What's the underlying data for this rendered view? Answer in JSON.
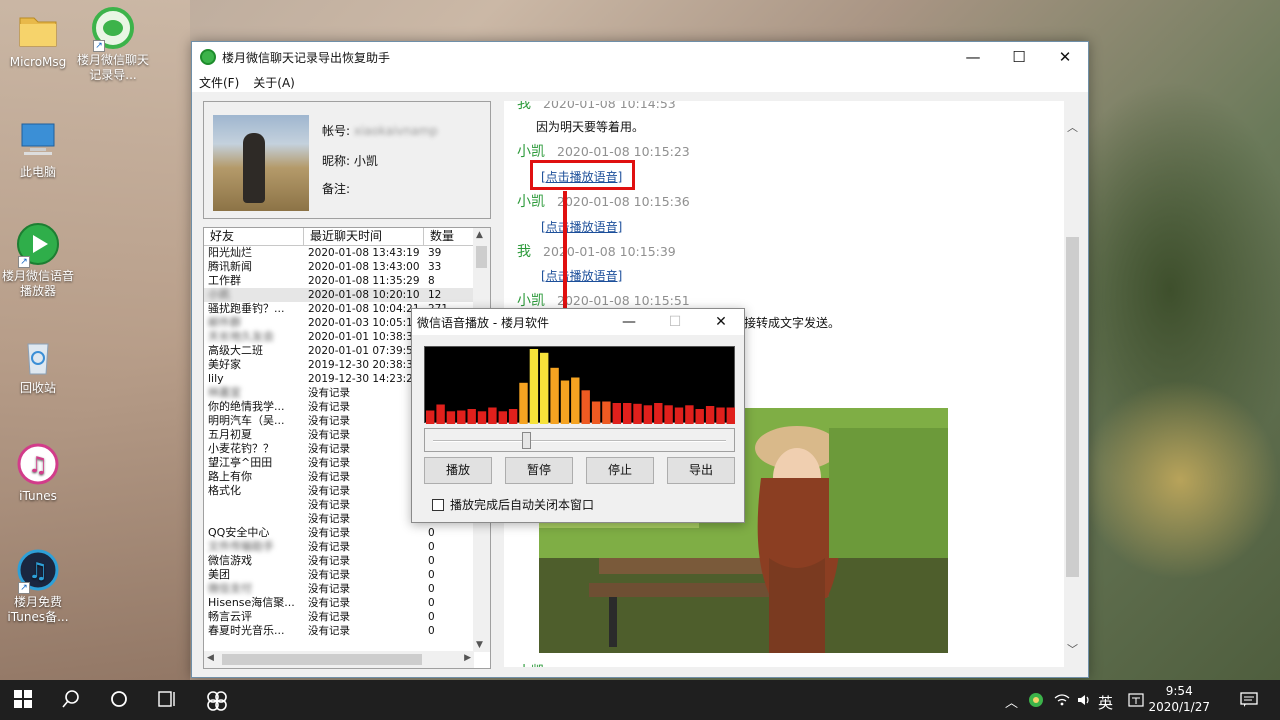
{
  "desktop": {
    "icons": [
      {
        "label": "MicroMsg"
      },
      {
        "label": "楼月微信聊天记录导..."
      },
      {
        "label": "此电脑"
      },
      {
        "label": "楼月微信语音播放器"
      },
      {
        "label": "回收站"
      },
      {
        "label": "iTunes"
      },
      {
        "label": "楼月免费iTunes备..."
      }
    ]
  },
  "window": {
    "title": "楼月微信聊天记录导出恢复助手",
    "min": "—",
    "max": "☐",
    "close": "✕",
    "menu": [
      "文件(F)",
      "关于(A)"
    ]
  },
  "profile": {
    "account_label": "帐号:",
    "account_value": "xiaokaivnamp",
    "nickname_label": "昵称:",
    "nickname_value": "小凯",
    "remark_label": "备注:",
    "remark_value": ""
  },
  "friend_list": {
    "headers": [
      "好友",
      "最近聊天时间",
      "数量"
    ],
    "rows": [
      {
        "name": "阳光灿烂",
        "time": "2020-01-08 13:43:19",
        "count": "39",
        "blur": false
      },
      {
        "name": "腾讯新闻",
        "time": "2020-01-08 13:43:00",
        "count": "33",
        "blur": false
      },
      {
        "name": "工作群",
        "time": "2020-01-08 11:35:29",
        "count": "8",
        "blur": false
      },
      {
        "name": "小凯",
        "time": "2020-01-08 10:20:10",
        "count": "12",
        "blur": true,
        "selected": true
      },
      {
        "name": "骚扰跑垂钓？...",
        "time": "2020-01-08 10:04:21",
        "count": "271",
        "blur": false
      },
      {
        "name": "邮件群",
        "time": "2020-01-03 10:05:18",
        "count": "",
        "blur": true
      },
      {
        "name": "天长地久友会",
        "time": "2020-01-01 10:38:35",
        "count": "",
        "blur": true
      },
      {
        "name": "高级大二班",
        "time": "2020-01-01 07:39:55",
        "count": "",
        "blur": false
      },
      {
        "name": "美好家",
        "time": "2019-12-30 20:38:32",
        "count": "",
        "blur": false
      },
      {
        "name": "lily",
        "time": "2019-12-30 14:23:22",
        "count": "",
        "blur": false
      },
      {
        "name": "林嘉宜",
        "time": "没有记录",
        "count": "",
        "blur": true
      },
      {
        "name": "你的绝情我学...",
        "time": "没有记录",
        "count": "",
        "blur": false
      },
      {
        "name": "明明汽车（吴...",
        "time": "没有记录",
        "count": "",
        "blur": false
      },
      {
        "name": "五月初夏",
        "time": "没有记录",
        "count": "",
        "blur": false
      },
      {
        "name": "小麦花钓？？",
        "time": "没有记录",
        "count": "",
        "blur": false
      },
      {
        "name": "望江亭^田田",
        "time": "没有记录",
        "count": "",
        "blur": false
      },
      {
        "name": "路上有你",
        "time": "没有记录",
        "count": "",
        "blur": false
      },
      {
        "name": "格式化",
        "time": "没有记录",
        "count": "",
        "blur": false
      },
      {
        "name": "",
        "time": "没有记录",
        "count": "",
        "blur": false
      },
      {
        "name": "",
        "time": "没有记录",
        "count": "0",
        "blur": false
      },
      {
        "name": "QQ安全中心",
        "time": "没有记录",
        "count": "0",
        "blur": false
      },
      {
        "name": "文件传输助手",
        "time": "没有记录",
        "count": "0",
        "blur": true
      },
      {
        "name": "微信游戏",
        "time": "没有记录",
        "count": "0",
        "blur": false
      },
      {
        "name": "美团",
        "time": "没有记录",
        "count": "0",
        "blur": false
      },
      {
        "name": "微信支付",
        "time": "没有记录",
        "count": "0",
        "blur": true
      },
      {
        "name": "Hisense海信聚...",
        "time": "没有记录",
        "count": "0",
        "blur": false
      },
      {
        "name": "畅言云评",
        "time": "没有记录",
        "count": "0",
        "blur": false
      },
      {
        "name": "春夏时光音乐...",
        "time": "没有记录",
        "count": "0",
        "blur": false
      }
    ]
  },
  "chat": {
    "messages": [
      {
        "sender": "我",
        "time": "2020-01-08 10:14:53",
        "color": "green"
      },
      {
        "text": "因为明天要等着用。"
      },
      {
        "sender": "小凯",
        "time": "2020-01-08 10:15:23",
        "color": "green"
      },
      {
        "link": "[点击播放语音]"
      },
      {
        "sender": "小凯",
        "time": "2020-01-08 10:15:36",
        "color": "green"
      },
      {
        "link": "[点击播放语音]"
      },
      {
        "sender": "我",
        "time": "2020-01-08 10:15:39",
        "color": "green"
      },
      {
        "link": "[点击播放语音]"
      },
      {
        "sender": "小凯",
        "time": "2020-01-08 10:15:51",
        "color": "green"
      },
      {
        "text": "接转成文字发送。"
      }
    ],
    "bottom_sender": "小凯"
  },
  "player": {
    "title": "微信语音播放 - 楼月软件",
    "min": "—",
    "max": "☐",
    "close": "✕",
    "bars": [
      0.18,
      0.26,
      0.17,
      0.18,
      0.2,
      0.17,
      0.22,
      0.17,
      0.2,
      0.55,
      1.0,
      0.95,
      0.75,
      0.58,
      0.62,
      0.45,
      0.3,
      0.3,
      0.28,
      0.28,
      0.27,
      0.25,
      0.28,
      0.25,
      0.22,
      0.25,
      0.2,
      0.24,
      0.22,
      0.22
    ],
    "seek_position": 0.31,
    "buttons": [
      "播放",
      "暂停",
      "停止",
      "导出"
    ],
    "auto_close_label": "播放完成后自动关闭本窗口"
  },
  "taskbar": {
    "lang": "英",
    "time": "9:54",
    "date": "2020/1/27"
  }
}
